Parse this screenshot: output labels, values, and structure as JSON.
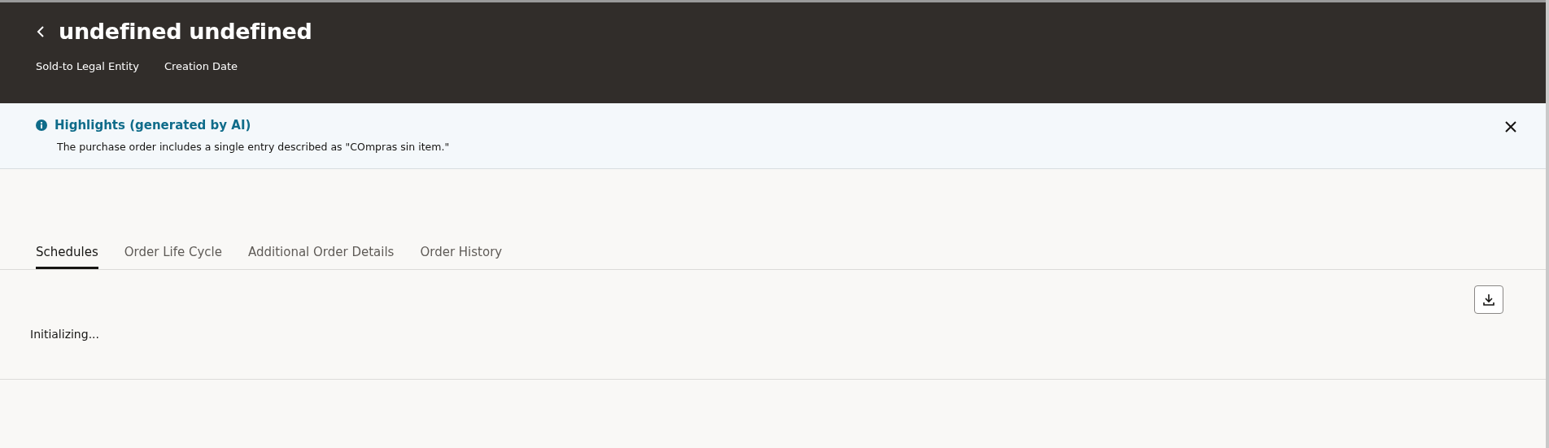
{
  "header": {
    "title": "undefined undefined",
    "fields": [
      "Sold-to Legal Entity",
      "Creation Date"
    ]
  },
  "highlights": {
    "title": "Highlights (generated by AI)",
    "text": "The purchase order includes a single entry described as \"COmpras sin item.\""
  },
  "tabs": [
    {
      "label": "Schedules",
      "selected": true
    },
    {
      "label": "Order Life Cycle",
      "selected": false
    },
    {
      "label": "Additional Order Details",
      "selected": false
    },
    {
      "label": "Order History",
      "selected": false
    }
  ],
  "status": "Initializing..."
}
